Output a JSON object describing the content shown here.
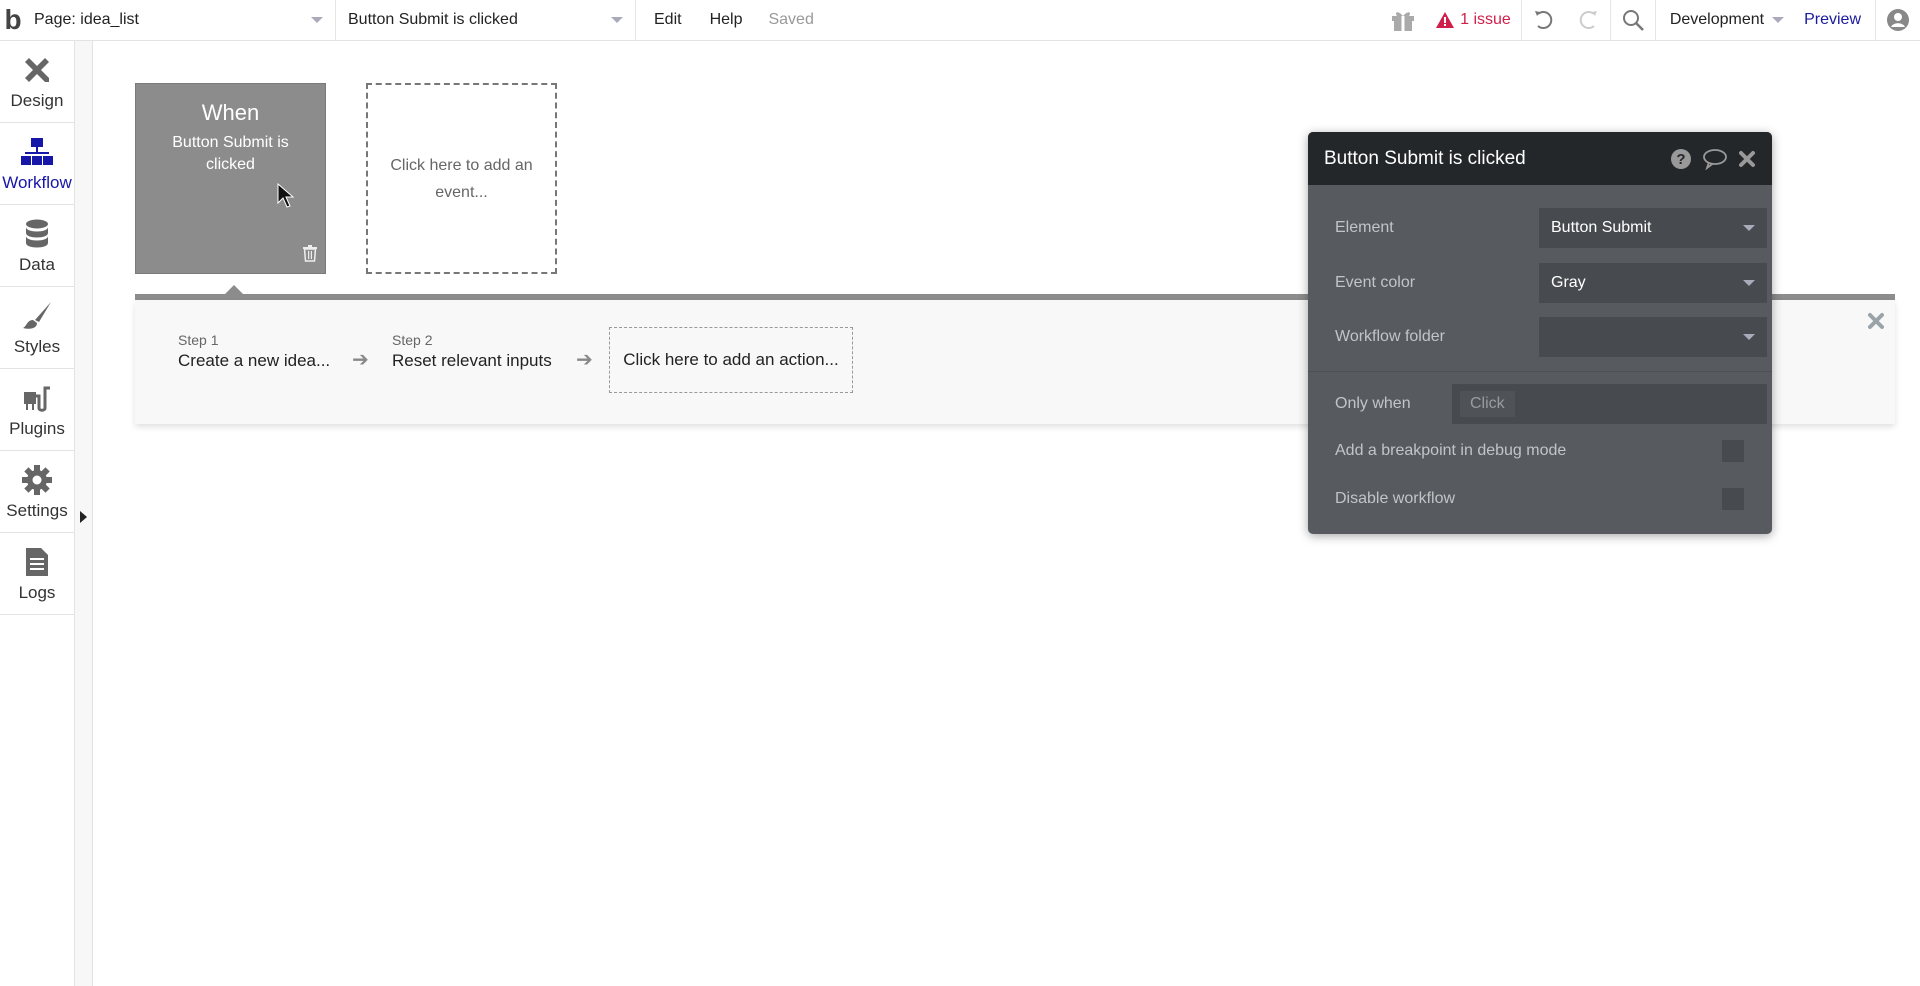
{
  "topbar": {
    "logo": "b",
    "page_selector": "Page: idea_list",
    "workflow_selector": "Button Submit is clicked",
    "menu": [
      "Edit",
      "Help"
    ],
    "save_status": "Saved",
    "issues": "1 issue",
    "environment": "Development",
    "preview": "Preview",
    "colors": {
      "issue": "#d0204a",
      "preview": "#1a1a9e"
    }
  },
  "sidebar": {
    "items": [
      {
        "label": "Design",
        "icon": "design-icon"
      },
      {
        "label": "Workflow",
        "icon": "workflow-icon",
        "active": true
      },
      {
        "label": "Data",
        "icon": "database-icon"
      },
      {
        "label": "Styles",
        "icon": "brush-icon"
      },
      {
        "label": "Plugins",
        "icon": "plug-icon"
      },
      {
        "label": "Settings",
        "icon": "gear-icon"
      },
      {
        "label": "Logs",
        "icon": "document-icon"
      }
    ],
    "active_color": "#1616a8"
  },
  "workflow": {
    "event": {
      "when": "When",
      "name": "Button Submit is clicked"
    },
    "add_event": "Click here to add an event...",
    "steps": [
      {
        "num": "Step 1",
        "name": "Create a new idea..."
      },
      {
        "num": "Step 2",
        "name": "Reset relevant inputs"
      }
    ],
    "add_action": "Click here to add an action..."
  },
  "panel": {
    "title": "Button Submit is clicked",
    "element_label": "Element",
    "element_value": "Button Submit",
    "color_label": "Event color",
    "color_value": "Gray",
    "folder_label": "Workflow folder",
    "folder_value": "",
    "only_when_label": "Only when",
    "only_when_placeholder": "Click",
    "breakpoint_label": "Add a breakpoint in debug mode",
    "disable_label": "Disable workflow"
  }
}
